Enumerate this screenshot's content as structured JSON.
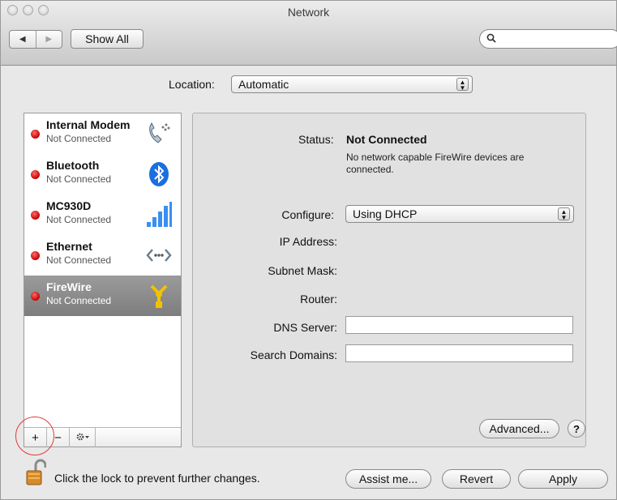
{
  "window": {
    "title": "Network"
  },
  "toolbar": {
    "back_glyph": "◀",
    "forward_glyph": "▶",
    "show_all_label": "Show All",
    "search_placeholder": ""
  },
  "location": {
    "label": "Location:",
    "value": "Automatic"
  },
  "services": [
    {
      "name": "Internal Modem",
      "status": "Not Connected",
      "icon": "phone-modem-icon",
      "selected": false
    },
    {
      "name": "Bluetooth",
      "status": "Not Connected",
      "icon": "bluetooth-icon",
      "selected": false
    },
    {
      "name": "MC930D",
      "status": "Not Connected",
      "icon": "signal-bars-icon",
      "selected": false
    },
    {
      "name": "Ethernet",
      "status": "Not Connected",
      "icon": "ethernet-icon",
      "selected": false
    },
    {
      "name": "FireWire",
      "status": "Not Connected",
      "icon": "firewire-icon",
      "selected": true
    }
  ],
  "service_toolbar": {
    "add": "+",
    "remove": "−"
  },
  "detail": {
    "status_label": "Status:",
    "status_value": "Not Connected",
    "status_message": "No network capable FireWire devices are connected.",
    "configure_label": "Configure:",
    "configure_value": "Using DHCP",
    "ip_label": "IP Address:",
    "subnet_label": "Subnet Mask:",
    "router_label": "Router:",
    "dns_label": "DNS Server:",
    "dns_value": "",
    "search_domains_label": "Search Domains:",
    "search_domains_value": "",
    "advanced_label": "Advanced...",
    "help_label": "?"
  },
  "footer": {
    "lock_text": "Click the lock to prevent further changes.",
    "assist_label": "Assist me...",
    "revert_label": "Revert",
    "apply_label": "Apply"
  },
  "colors": {
    "status_dot": "#d10000",
    "selection": "#8a8a8a",
    "highlight_circle": "#e23b3b"
  }
}
